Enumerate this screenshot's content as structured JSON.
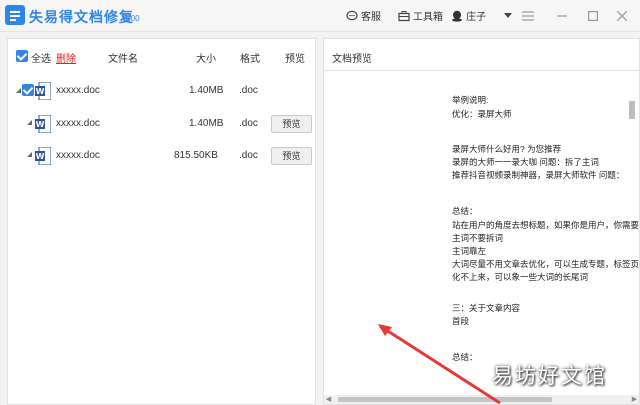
{
  "app": {
    "title": "失易得文档修复",
    "version": "1.00"
  },
  "titlebar": {
    "support_label": "客服",
    "toolbox_label": "工具箱",
    "user_label": "庄子"
  },
  "left": {
    "select_all_label": "全选",
    "delete_label": "删除",
    "columns": {
      "name": "文件名",
      "size": "大小",
      "format": "格式",
      "preview": "预览"
    },
    "rows": [
      {
        "name": "xxxxx.doc",
        "size": "1.40MB",
        "format": ".doc",
        "preview": ""
      },
      {
        "name": "xxxxx.doc",
        "size": "1.40MB",
        "format": ".doc",
        "preview": "预览"
      },
      {
        "name": "xxxxx.doc",
        "size": "815.50KB",
        "format": ".doc",
        "preview": "预览"
      }
    ]
  },
  "right": {
    "title": "文档预览",
    "lines": [
      "举例说明:",
      "优化：录屏大师",
      "录屏大师什么好用? 为您推荐",
      "录屏的大师一一录大咖    问题：拆了主词",
      "推荐抖音视频录制神器，录屏大师软件     问题：",
      "总结：",
      "站在用户的角度去想标题，如果你是用户，你需要",
      "主词不要拆词",
      "主词靠左",
      "大词尽量不用文章去优化，可以生成专题，标签页",
      "化不上来，可以象一些大词的长尾词",
      "三：关于文章内容",
      "首段",
      "总结："
    ]
  },
  "watermark": "易坊好文馆",
  "colors": {
    "accent": "#2f86e8",
    "danger": "#e02020",
    "arrow": "#e53935"
  }
}
